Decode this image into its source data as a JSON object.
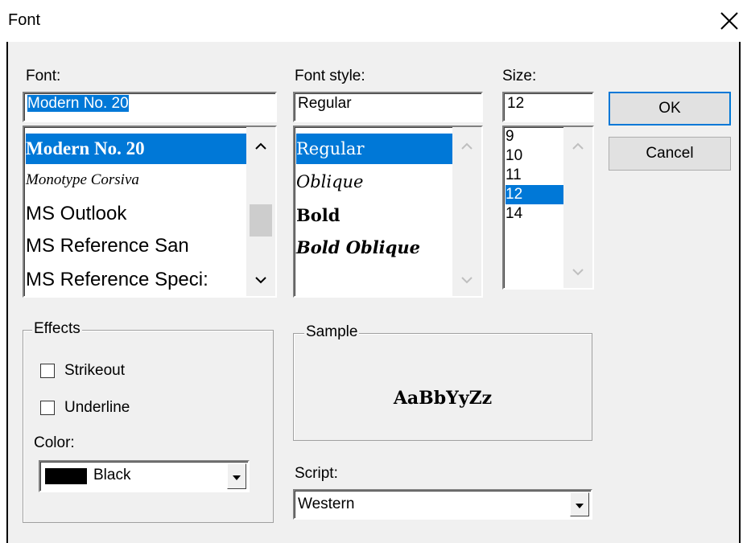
{
  "window": {
    "title": "Font"
  },
  "font": {
    "label": "Font:",
    "value": "Modern No. 20",
    "items": [
      "Modern No. 20",
      "Monotype Corsiva",
      "MS Outlook",
      "MS Reference San",
      "MS Reference Speci:"
    ],
    "selected_index": 0
  },
  "style": {
    "label": "Font style:",
    "value": "Regular",
    "items": [
      "Regular",
      "Oblique",
      "Bold",
      "Bold Oblique"
    ],
    "selected_index": 0
  },
  "size": {
    "label": "Size:",
    "value": "12",
    "items": [
      "9",
      "10",
      "11",
      "12",
      "14"
    ],
    "selected_index": 3
  },
  "buttons": {
    "ok": "OK",
    "cancel": "Cancel"
  },
  "effects": {
    "legend": "Effects",
    "strikeout": "Strikeout",
    "underline": "Underline",
    "strikeout_checked": false,
    "underline_checked": false,
    "color_label": "Color:",
    "color_value": "Black",
    "color_swatch": "#000000"
  },
  "sample": {
    "legend": "Sample",
    "text": "AaBbYyZz"
  },
  "script": {
    "label": "Script:",
    "value": "Western"
  },
  "colors": {
    "selection": "#0078d7",
    "dialog_bg": "#f0f0f0"
  }
}
